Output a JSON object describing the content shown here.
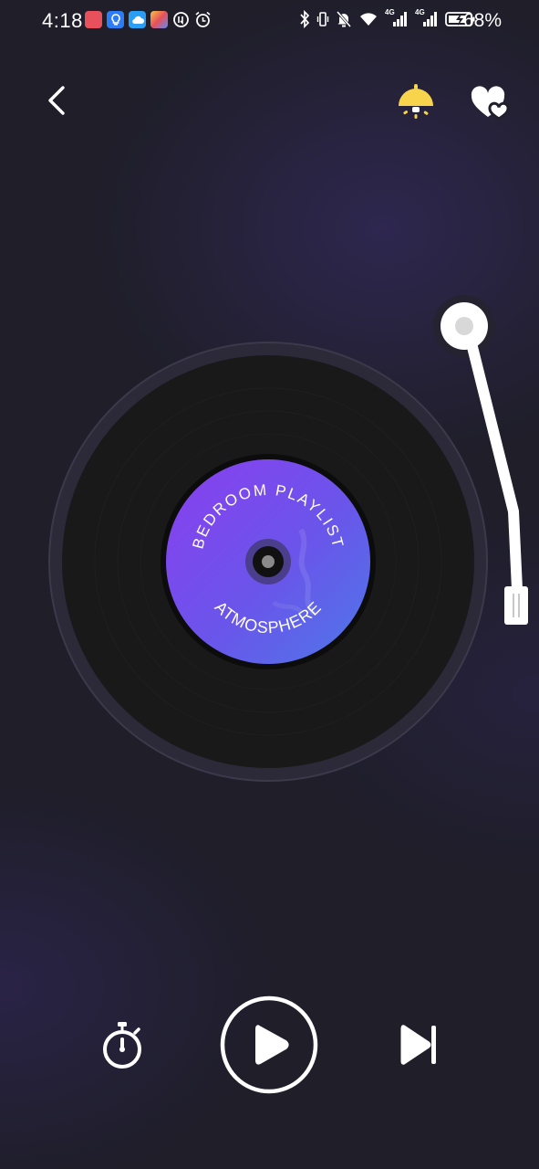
{
  "status_bar": {
    "time": "4:18",
    "battery_percent": "68%",
    "network_1": "4G",
    "network_2": "4G"
  },
  "header": {
    "back_icon": "chevron-left-icon",
    "lamp_icon": "lamp-icon",
    "favorite_icon": "heart-favorites-icon"
  },
  "record": {
    "label_top": "BEDROOM PLAYLIST",
    "label_bottom": "ATMOSPHERE"
  },
  "controls": {
    "timer_icon": "stopwatch-icon",
    "play_icon": "play-icon",
    "next_icon": "skip-next-icon"
  },
  "colors": {
    "background": "#1f1e29",
    "lamp_yellow": "#f7d44c",
    "label_purple": "#7a46e6",
    "label_blue": "#5a6ae6",
    "vinyl": "#181818"
  }
}
